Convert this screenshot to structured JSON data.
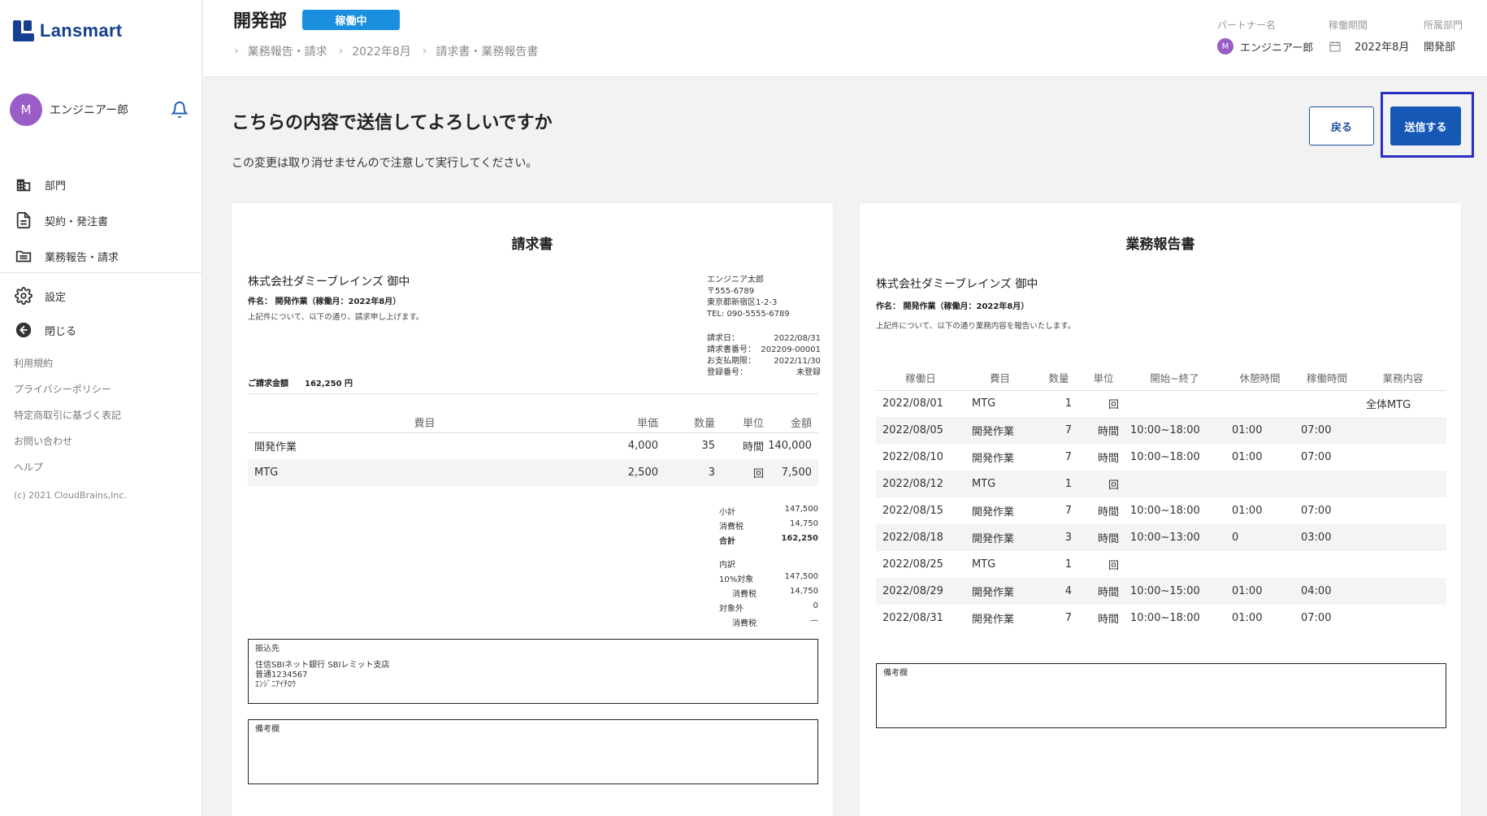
{
  "app": {
    "name": "Lansmart"
  },
  "sidebar": {
    "user_initial": "M",
    "user_name": "エンジニアー郎",
    "items": [
      {
        "label": "部門",
        "icon": "building-icon"
      },
      {
        "label": "契約・発注書",
        "icon": "document-icon"
      },
      {
        "label": "業務報告・請求",
        "icon": "folder-icon"
      }
    ],
    "settings_label": "設定",
    "close_label": "閉じる",
    "links": [
      "利用規約",
      "プライバシーポリシー",
      "特定商取引に基づく表記",
      "お問い合わせ",
      "ヘルプ"
    ],
    "copyright": "(c) 2021 CloudBrains,Inc."
  },
  "header": {
    "title": "開発部",
    "status_badge": "稼働中",
    "breadcrumb": [
      "業務報告・請求",
      "2022年8月",
      "請求書・業務報告書"
    ],
    "partner_label": "パートナー名",
    "partner_initial": "M",
    "partner_value": "エンジニアー郎",
    "period_label": "稼働期間",
    "period_value": "2022年8月",
    "dept_label": "所属部門",
    "dept_value": "開発部"
  },
  "confirm": {
    "title": "こちらの内容で送信してよろしいですか",
    "subtitle": "この変更は取り消せませんので注意して実行してください。",
    "back_label": "戻る",
    "send_label": "送信する"
  },
  "invoice": {
    "title": "請求書",
    "client": "株式会社ダミーブレインズ 御中",
    "subject": "件名： 開発作業（稼働月：2022年8月）",
    "note": "上記件について、以下の通り、請求申し上げます。",
    "issuer": [
      "エンジニア太郎",
      "〒555-6789",
      "東京都新宿区1-2-3",
      "TEL: 090-5555-6789"
    ],
    "info": [
      {
        "label": "請求日：",
        "value": "2022/08/31"
      },
      {
        "label": "請求書番号：",
        "value": "202209-00001"
      },
      {
        "label": "お支払期限：",
        "value": "2022/11/30"
      },
      {
        "label": "登録番号：",
        "value": "未登録"
      }
    ],
    "total_label": "ご請求金額",
    "total_value": "162,250 円",
    "columns": [
      "費目",
      "単価",
      "数量",
      "単位",
      "金額"
    ],
    "rows": [
      {
        "item": "開発作業",
        "price": "4,000",
        "qty": "35",
        "unit": "時間",
        "amount": "140,000"
      },
      {
        "item": "MTG",
        "price": "2,500",
        "qty": "3",
        "unit": "回",
        "amount": "7,500"
      }
    ],
    "summary": [
      {
        "label": "小計",
        "value": "147,500"
      },
      {
        "label": "消費税",
        "value": "14,750"
      },
      {
        "label": "合計",
        "value": "162,250"
      }
    ],
    "breakdown_label": "内訳",
    "breakdown": [
      {
        "label": "10%対象",
        "value": "147,500"
      },
      {
        "label": "消費税",
        "value": "14,750"
      },
      {
        "label": "対象外",
        "value": "0"
      },
      {
        "label": "消費税",
        "value": "—"
      }
    ],
    "bank_label": "振込先",
    "bank_lines": [
      "住信SBIネット銀行 SBIレミット支店",
      "普通1234567",
      "ｴﾝｼﾞﾆｱｲﾁﾛｳ"
    ],
    "remarks_label": "備考欄"
  },
  "report": {
    "title": "業務報告書",
    "client": "株式会社ダミーブレインズ 御中",
    "subject": "作名： 開発作業（稼働月：2022年8月）",
    "note": "上記件について、以下の通り業務内容を報告いたします。",
    "columns": [
      "稼働日",
      "費目",
      "数量",
      "単位",
      "開始~終了",
      "休憩時間",
      "稼働時間",
      "業務内容"
    ],
    "rows": [
      {
        "date": "2022/08/01",
        "item": "MTG",
        "qty": "1",
        "unit": "回",
        "range": "",
        "rest": "",
        "work": "",
        "desc": "全体MTG"
      },
      {
        "date": "2022/08/05",
        "item": "開発作業",
        "qty": "7",
        "unit": "時間",
        "range": "10:00~18:00",
        "rest": "01:00",
        "work": "07:00",
        "desc": ""
      },
      {
        "date": "2022/08/10",
        "item": "開発作業",
        "qty": "7",
        "unit": "時間",
        "range": "10:00~18:00",
        "rest": "01:00",
        "work": "07:00",
        "desc": ""
      },
      {
        "date": "2022/08/12",
        "item": "MTG",
        "qty": "1",
        "unit": "回",
        "range": "",
        "rest": "",
        "work": "",
        "desc": ""
      },
      {
        "date": "2022/08/15",
        "item": "開発作業",
        "qty": "7",
        "unit": "時間",
        "range": "10:00~18:00",
        "rest": "01:00",
        "work": "07:00",
        "desc": ""
      },
      {
        "date": "2022/08/18",
        "item": "開発作業",
        "qty": "3",
        "unit": "時間",
        "range": "10:00~13:00",
        "rest": "0",
        "work": "03:00",
        "desc": ""
      },
      {
        "date": "2022/08/25",
        "item": "MTG",
        "qty": "1",
        "unit": "回",
        "range": "",
        "rest": "",
        "work": "",
        "desc": ""
      },
      {
        "date": "2022/08/29",
        "item": "開発作業",
        "qty": "4",
        "unit": "時間",
        "range": "10:00~15:00",
        "rest": "01:00",
        "work": "04:00",
        "desc": ""
      },
      {
        "date": "2022/08/31",
        "item": "開発作業",
        "qty": "7",
        "unit": "時間",
        "range": "10:00~18:00",
        "rest": "01:00",
        "work": "07:00",
        "desc": ""
      }
    ],
    "remarks_label": "備考欄"
  },
  "colors": {
    "brand": "#173f8f",
    "primary": "#1558b6",
    "badge": "#1a8fe0",
    "avatar": "#9a5cc6"
  }
}
